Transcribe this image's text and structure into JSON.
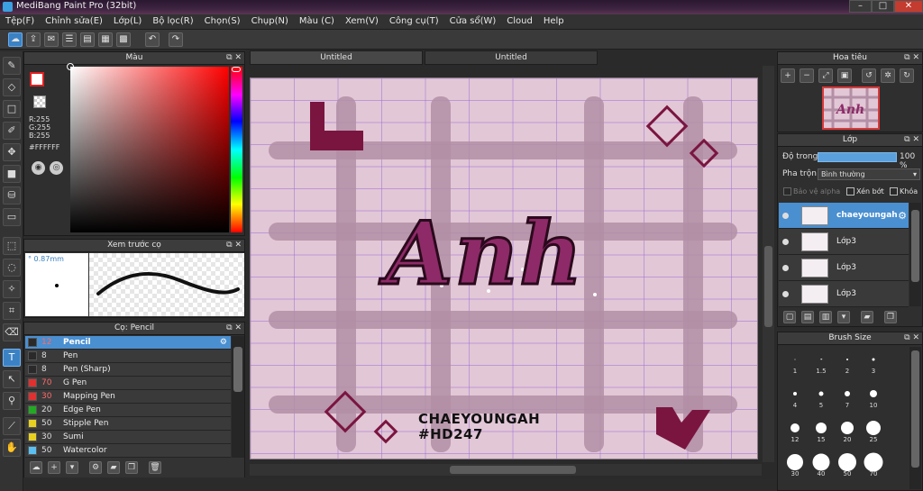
{
  "window": {
    "title": "MediBang Paint Pro (32bit)",
    "min": "–",
    "max": "□",
    "close": "✕"
  },
  "menu": [
    "Tệp(F)",
    "Chỉnh sửa(E)",
    "Lớp(L)",
    "Bộ lọc(R)",
    "Chọn(S)",
    "Chụp(N)",
    "Màu (C)",
    "Xem(V)",
    "Công cụ(T)",
    "Cửa sổ(W)",
    "Cloud",
    "Help"
  ],
  "color_panel": {
    "title": "Màu",
    "rgb": [
      "R:255",
      "G:255",
      "B:255"
    ],
    "hex": "#FFFFFF",
    "current_color": "#ffffff"
  },
  "preview_panel": {
    "title": "Xem trước cọ",
    "size": "0.87mm"
  },
  "brush_panel": {
    "title": "Cọ: Pencil",
    "brushes": [
      {
        "size": "12",
        "name": "Pencil",
        "color": "#2a2a2a",
        "selected": true,
        "red": true
      },
      {
        "size": "8",
        "name": "Pen",
        "color": "#2a2a2a",
        "selected": false,
        "red": false
      },
      {
        "size": "8",
        "name": "Pen (Sharp)",
        "color": "#2a2a2a",
        "selected": false,
        "red": false
      },
      {
        "size": "70",
        "name": "G Pen",
        "color": "#e03030",
        "selected": false,
        "red": true
      },
      {
        "size": "30",
        "name": "Mapping Pen",
        "color": "#e03030",
        "selected": false,
        "red": true
      },
      {
        "size": "20",
        "name": "Edge Pen",
        "color": "#22aa22",
        "selected": false,
        "red": false
      },
      {
        "size": "50",
        "name": "Stipple Pen",
        "color": "#e8d020",
        "selected": false,
        "red": false
      },
      {
        "size": "30",
        "name": "Sumi",
        "color": "#e8d020",
        "selected": false,
        "red": false
      },
      {
        "size": "50",
        "name": "Watercolor",
        "color": "#5bc0f0",
        "selected": false,
        "red": false
      }
    ]
  },
  "canvas": {
    "tabs": [
      "Untitled",
      "Untitled"
    ],
    "main_text": "Anh",
    "caption_line1": "CHAEYOUNGAH",
    "caption_line2": "#HD247",
    "bg_color": "#e2c7d6",
    "accent_color": "#7a1540",
    "text_color": "#8e2a68"
  },
  "navigator": {
    "title": "Hoa tiêu"
  },
  "layer_panel": {
    "title": "Lớp",
    "opacity_label": "Độ trong",
    "opacity_value": "100 %",
    "opacity_fraction": 1.0,
    "blend_label": "Pha trộn",
    "blend_value": "Bình thường",
    "protect_alpha": "Bảo vệ alpha",
    "clipping": "Xén bớt",
    "lock": "Khóa",
    "layers": [
      {
        "name": "chaeyoungah",
        "selected": true
      },
      {
        "name": "Lớp3",
        "selected": false
      },
      {
        "name": "Lớp3",
        "selected": false
      },
      {
        "name": "Lớp3",
        "selected": false
      }
    ]
  },
  "brush_size_panel": {
    "title": "Brush Size",
    "sizes": [
      {
        "label": "1",
        "d": 1
      },
      {
        "label": "1.5",
        "d": 1.5
      },
      {
        "label": "2",
        "d": 2
      },
      {
        "label": "3",
        "d": 3
      },
      {
        "label": "4",
        "d": 4
      },
      {
        "label": "5",
        "d": 5
      },
      {
        "label": "7",
        "d": 6
      },
      {
        "label": "10",
        "d": 8
      },
      {
        "label": "12",
        "d": 10
      },
      {
        "label": "15",
        "d": 12
      },
      {
        "label": "20",
        "d": 14
      },
      {
        "label": "25",
        "d": 16
      },
      {
        "label": "30",
        "d": 18
      },
      {
        "label": "40",
        "d": 19
      },
      {
        "label": "50",
        "d": 20
      },
      {
        "label": "70",
        "d": 21
      }
    ]
  }
}
